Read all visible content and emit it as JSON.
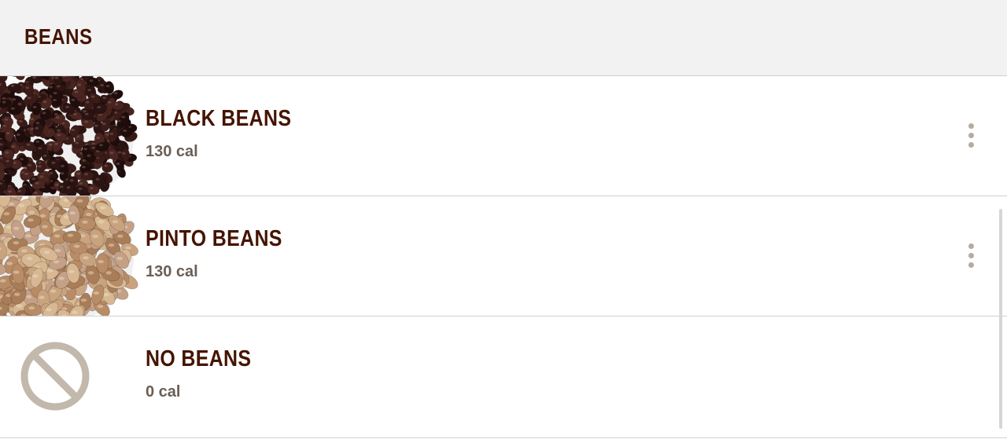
{
  "header": {
    "title": "BEANS"
  },
  "items": [
    {
      "name": "BLACK BEANS",
      "calories": "130 cal",
      "image_icon": "black-beans-image",
      "has_more_menu": true
    },
    {
      "name": "PINTO BEANS",
      "calories": "130 cal",
      "image_icon": "pinto-beans-image",
      "has_more_menu": true
    },
    {
      "name": "NO BEANS",
      "calories": "0 cal",
      "image_icon": "no-symbol-icon",
      "has_more_menu": false
    }
  ],
  "colors": {
    "title_text": "#451400",
    "calorie_text": "#6b5e55",
    "header_bg": "#f2f2f2",
    "icon_gray": "#b6ab9e",
    "no_symbol": "#c2b8ab"
  }
}
